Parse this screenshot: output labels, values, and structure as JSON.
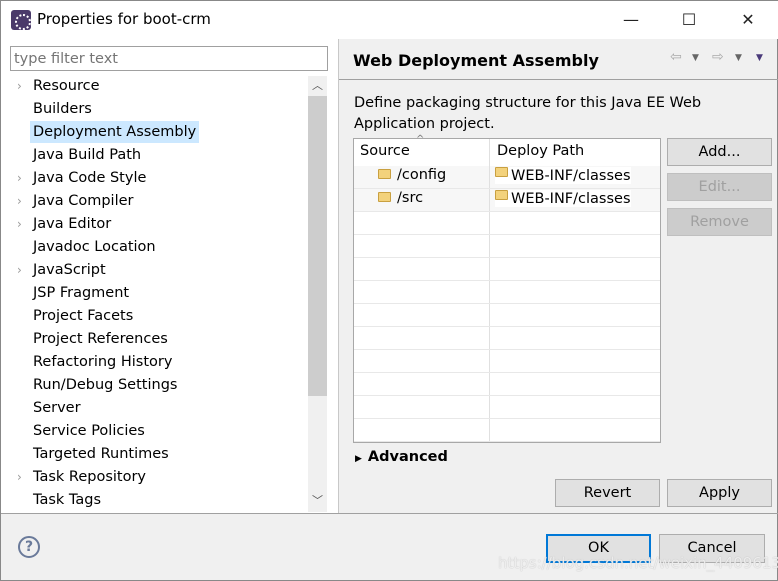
{
  "window": {
    "title": "Properties for boot-crm",
    "minimize": "—",
    "maximize": "☐",
    "close": "✕"
  },
  "filter": {
    "placeholder": "type filter text"
  },
  "tree": {
    "items": [
      {
        "label": "Resource",
        "expandable": true
      },
      {
        "label": "Builders",
        "expandable": false
      },
      {
        "label": "Deployment Assembly",
        "expandable": false,
        "selected": true
      },
      {
        "label": "Java Build Path",
        "expandable": false
      },
      {
        "label": "Java Code Style",
        "expandable": true
      },
      {
        "label": "Java Compiler",
        "expandable": true
      },
      {
        "label": "Java Editor",
        "expandable": true
      },
      {
        "label": "Javadoc Location",
        "expandable": false
      },
      {
        "label": "JavaScript",
        "expandable": true
      },
      {
        "label": "JSP Fragment",
        "expandable": false
      },
      {
        "label": "Project Facets",
        "expandable": false
      },
      {
        "label": "Project References",
        "expandable": false
      },
      {
        "label": "Refactoring History",
        "expandable": false
      },
      {
        "label": "Run/Debug Settings",
        "expandable": false
      },
      {
        "label": "Server",
        "expandable": false
      },
      {
        "label": "Service Policies",
        "expandable": false
      },
      {
        "label": "Targeted Runtimes",
        "expandable": false
      },
      {
        "label": "Task Repository",
        "expandable": true
      },
      {
        "label": "Task Tags",
        "expandable": false
      }
    ]
  },
  "page": {
    "title": "Web Deployment Assembly",
    "description": "Define packaging structure for this Java EE Web Application project."
  },
  "table": {
    "headers": [
      "Source",
      "Deploy Path"
    ],
    "rows": [
      {
        "source": "/config",
        "deploy_path": "WEB-INF/classes"
      },
      {
        "source": "/src",
        "deploy_path": "WEB-INF/classes"
      }
    ]
  },
  "buttons": {
    "add": "Add...",
    "edit": "Edit...",
    "remove": "Remove",
    "revert": "Revert",
    "apply": "Apply",
    "ok": "OK",
    "cancel": "Cancel"
  },
  "advanced": {
    "label": "Advanced"
  },
  "watermark": "https://blog.csdn.net/weixin_44096133",
  "colors": {
    "selection": "#cce8ff",
    "default_button_border": "#0078d7"
  }
}
